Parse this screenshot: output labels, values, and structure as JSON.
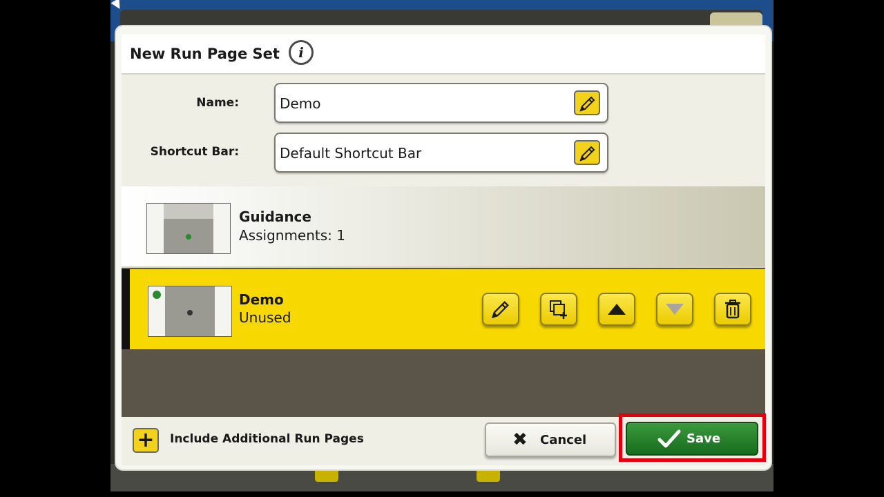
{
  "dialog": {
    "title": "New Run Page Set",
    "info_icon": "info-icon"
  },
  "form": {
    "name_label": "Name:",
    "name_value": "Demo",
    "shortcut_label": "Shortcut Bar:",
    "shortcut_value": "Default Shortcut Bar",
    "edit_icon": "pencil-icon"
  },
  "run_pages": [
    {
      "title": "Guidance",
      "subtitle": "Assignments: 1",
      "selected": false
    },
    {
      "title": "Demo",
      "subtitle": "Unused",
      "selected": true
    }
  ],
  "row_actions": {
    "edit_icon": "pencil-icon",
    "copy_icon": "copy-add-icon",
    "up_icon": "arrow-up-icon",
    "down_icon": "arrow-down-icon",
    "delete_icon": "trash-icon"
  },
  "footer": {
    "include_label": "Include Additional Run Pages",
    "include_icon": "plus-icon",
    "cancel_label": "Cancel",
    "cancel_icon": "x-icon",
    "save_label": "Save",
    "save_icon": "check-icon"
  },
  "colors": {
    "accent_yellow": "#f7d800",
    "save_green": "#1f7a24",
    "highlight_red": "#e2000f"
  }
}
